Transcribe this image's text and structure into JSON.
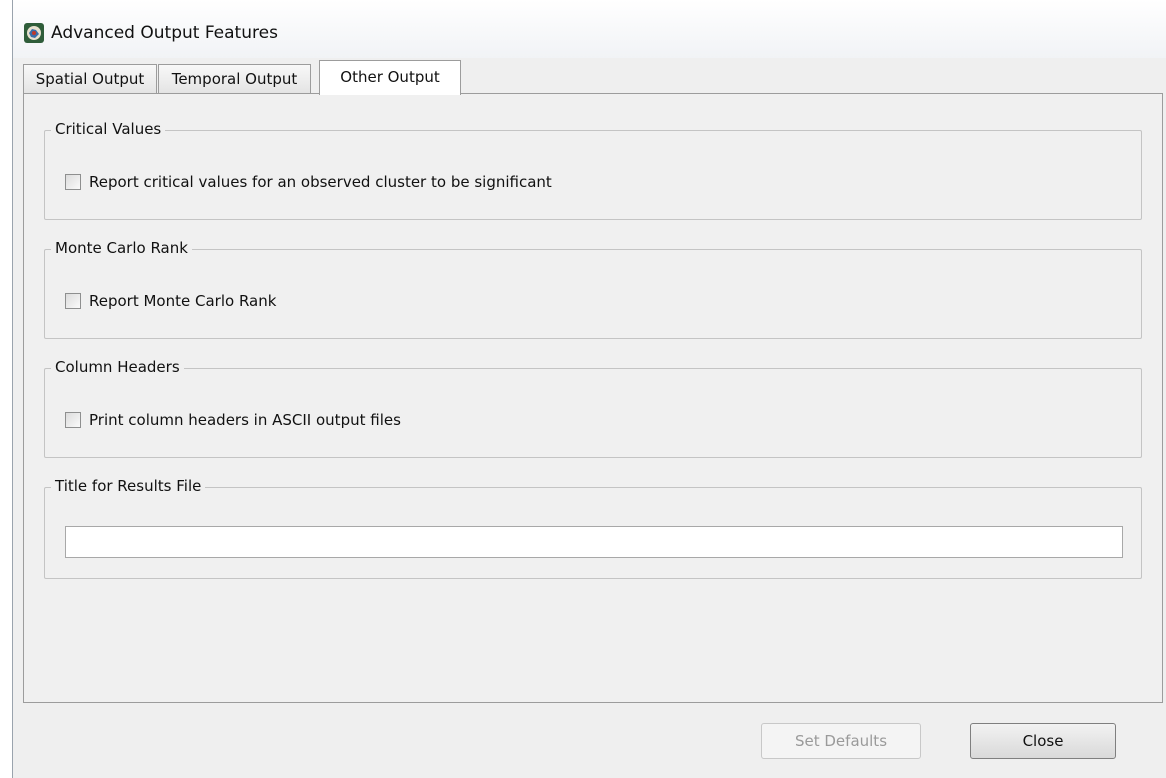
{
  "window": {
    "title": "Advanced Output Features",
    "icon": "app-icon"
  },
  "tabs": [
    {
      "label": "Spatial Output",
      "active": false
    },
    {
      "label": "Temporal Output",
      "active": false
    },
    {
      "label": "Other Output",
      "active": true
    }
  ],
  "groups": {
    "critical_values": {
      "title": "Critical Values",
      "checkbox_label": "Report critical values for an observed cluster to be significant",
      "checked": false
    },
    "monte_carlo": {
      "title": "Monte Carlo Rank",
      "checkbox_label": "Report Monte Carlo Rank",
      "checked": false
    },
    "column_headers": {
      "title": "Column Headers",
      "checkbox_label": "Print column headers in ASCII output files",
      "checked": false
    },
    "results_title": {
      "title": "Title for Results File",
      "value": ""
    }
  },
  "buttons": {
    "set_defaults": "Set Defaults",
    "set_defaults_enabled": false,
    "close": "Close"
  }
}
